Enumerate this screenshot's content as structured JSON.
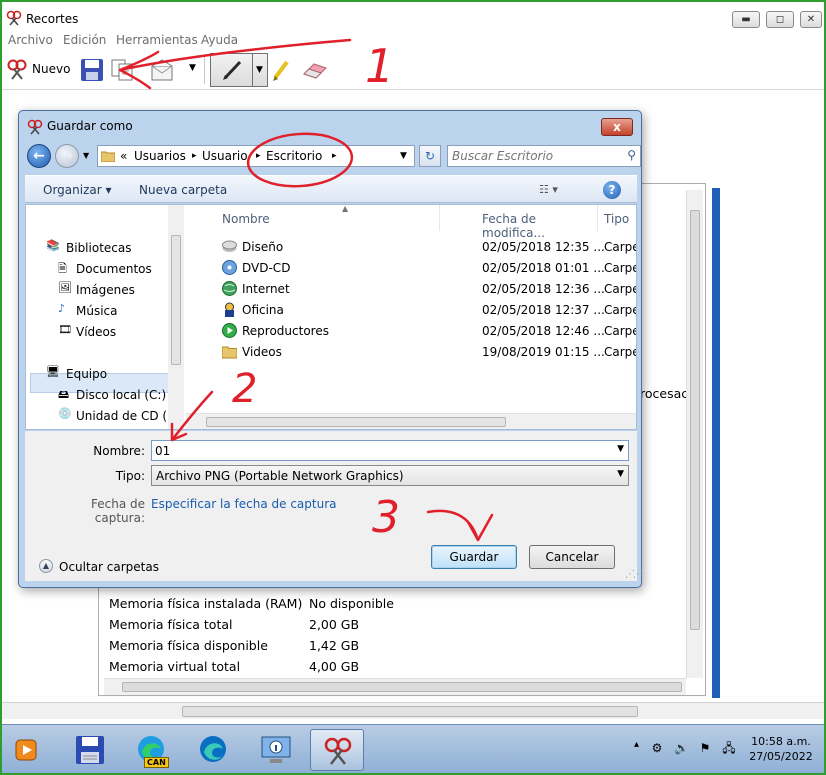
{
  "window": {
    "title": "Recortes",
    "menu": [
      "Archivo",
      "Edición",
      "Herramientas",
      "Ayuda"
    ],
    "toolbar": {
      "new_label": "Nuevo"
    },
    "controls": {
      "minimize": "▬",
      "maximize": "◻",
      "close": "✕"
    }
  },
  "background_info": {
    "partial_text": "rocesac",
    "rows": [
      {
        "label": "Memoria física instalada (RAM)",
        "value": "No disponible"
      },
      {
        "label": "Memoria física total",
        "value": "2,00 GB"
      },
      {
        "label": "Memoria física disponible",
        "value": "1,42 GB"
      },
      {
        "label": "Memoria virtual total",
        "value": "4,00 GB"
      }
    ]
  },
  "dialog": {
    "title": "Guardar como",
    "close_label": "x",
    "breadcrumb": {
      "root": "«",
      "parts": [
        "Usuarios",
        "Usuario",
        "Escritorio"
      ],
      "sep": "▸"
    },
    "search_placeholder": "Buscar Escritorio",
    "commands": {
      "organize": "Organizar ▾",
      "new_folder": "Nueva carpeta",
      "help": "?"
    },
    "nav": {
      "libraries": "Bibliotecas",
      "library_items": [
        "Documentos",
        "Imágenes",
        "Música",
        "Vídeos"
      ],
      "computer": "Equipo",
      "drives": [
        "Disco local (C:)",
        "Unidad de CD (D:"
      ]
    },
    "columns": [
      "Nombre",
      "Fecha de modifica...",
      "Tipo"
    ],
    "files": [
      {
        "name": "Diseño",
        "date": "02/05/2018 12:35 ...",
        "type": "Carpeta d"
      },
      {
        "name": "DVD-CD",
        "date": "02/05/2018 01:01 ...",
        "type": "Carpeta d"
      },
      {
        "name": "Internet",
        "date": "02/05/2018 12:36 ...",
        "type": "Carpeta d"
      },
      {
        "name": "Oficina",
        "date": "02/05/2018 12:37 ...",
        "type": "Carpeta d"
      },
      {
        "name": "Reproductores",
        "date": "02/05/2018 12:46 ...",
        "type": "Carpeta d"
      },
      {
        "name": "Videos",
        "date": "19/08/2019 01:15 ...",
        "type": "Carpeta d"
      }
    ],
    "form": {
      "name_label": "Nombre:",
      "name_value": "01",
      "type_label": "Tipo:",
      "type_value": "Archivo PNG (Portable Network Graphics)",
      "capture_label": "Fecha de captura:",
      "capture_link": "Especificar la fecha de captura",
      "hide_folders": "Ocultar carpetas",
      "save": "Guardar",
      "cancel": "Cancelar"
    }
  },
  "annotations": [
    "1",
    "2",
    "3"
  ],
  "taskbar": {
    "badge": "CAN",
    "time": "10:58 a.m.",
    "date": "27/05/2022"
  }
}
